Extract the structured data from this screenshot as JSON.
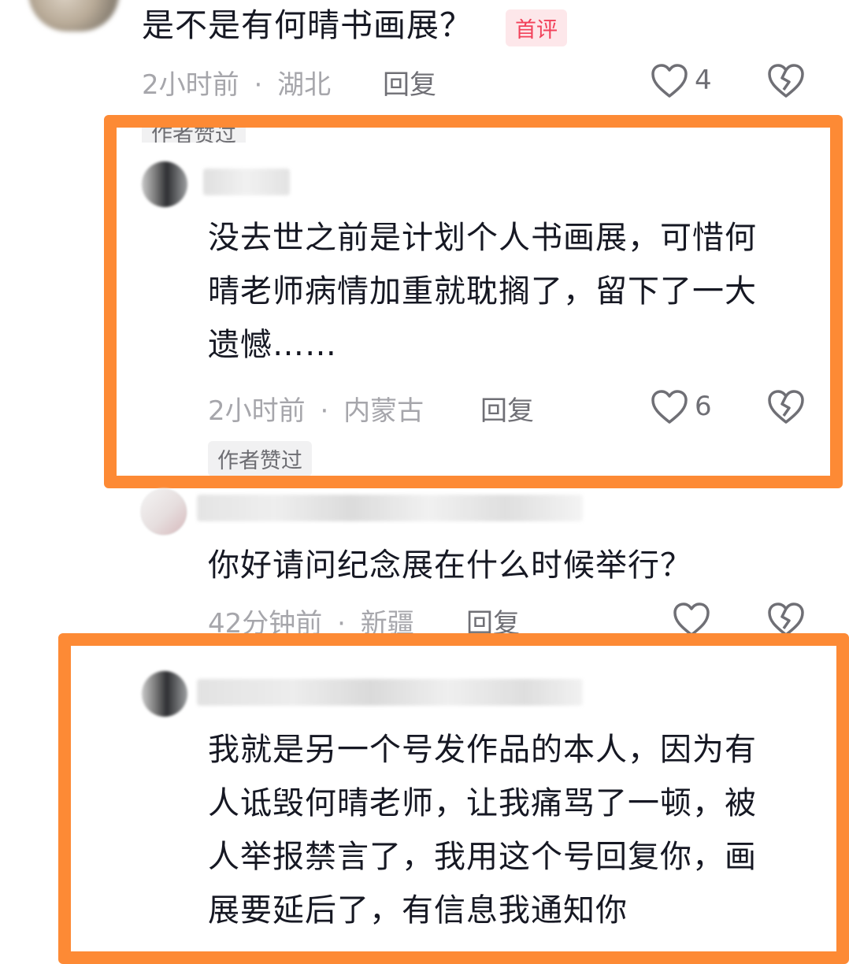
{
  "colors": {
    "highlight": "#fd8a35",
    "text": "#161823",
    "meta": "#a6a6ab",
    "first_badge_bg": "#fde7ea",
    "first_badge_fg": "#f2415a"
  },
  "comments": [
    {
      "text": "是不是有何晴书画展？",
      "badge": "首评",
      "time": "2小时前",
      "location": "湖北",
      "separator": "·",
      "reply_label": "回复",
      "likes": "4",
      "icons": [
        "like-heart-icon",
        "dislike-broken-heart-icon"
      ]
    },
    {
      "tag_top": "作者赞过",
      "text_lines": [
        "没去世之前是计划个人书画展，可惜何",
        "晴老师病情加重就耽搁了，留下了一大",
        "遗憾……"
      ],
      "time": "2小时前",
      "location": "内蒙古",
      "separator": "·",
      "reply_label": "回复",
      "likes": "6",
      "tag_bottom": "作者赞过",
      "icons": [
        "like-heart-icon",
        "dislike-broken-heart-icon"
      ]
    },
    {
      "text": "你好请问纪念展在什么时候举行？",
      "time": "42分钟前",
      "location": "新疆",
      "separator": "·",
      "reply_label": "回复",
      "icons": [
        "like-heart-icon",
        "dislike-broken-heart-icon"
      ]
    },
    {
      "text_lines": [
        "我就是另一个号发作品的本人，因为有",
        "人诋毁何晴老师，让我痛骂了一顿，被",
        "人举报禁言了，我用这个号回复你，画",
        "展要延后了，有信息我通知你"
      ]
    }
  ]
}
